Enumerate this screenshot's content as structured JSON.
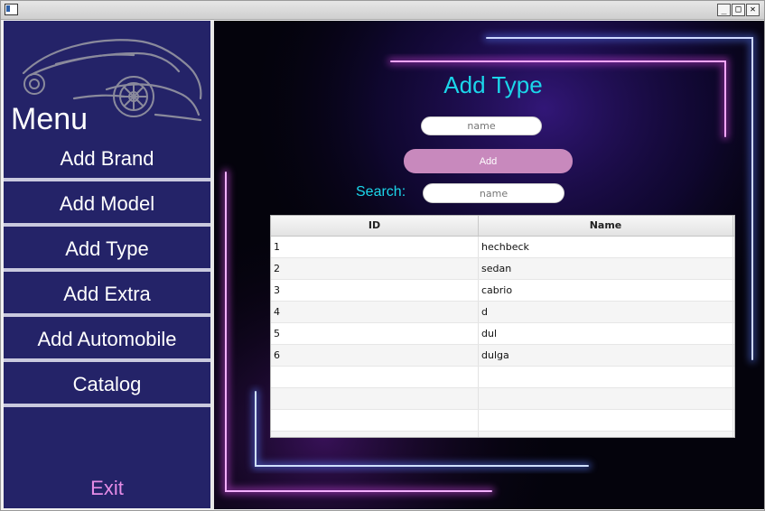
{
  "titlebar": {
    "buttons": [
      "_",
      "□",
      "✕"
    ]
  },
  "sidebar": {
    "logo_icon": "car-silhouette-icon",
    "menu_title": "Menu",
    "items": [
      {
        "label": "Add Brand"
      },
      {
        "label": "Add Model"
      },
      {
        "label": "Add Type"
      },
      {
        "label": "Add Extra"
      },
      {
        "label": "Add Automobile"
      },
      {
        "label": "Catalog"
      }
    ],
    "exit_label": "Exit"
  },
  "main": {
    "title": "Add Type",
    "name_placeholder": "name",
    "add_label": "Add",
    "search_label": "Search:",
    "search_placeholder": "name",
    "table": {
      "columns": [
        "ID",
        "Name"
      ],
      "rows": [
        [
          "1",
          "hechbeck"
        ],
        [
          "2",
          "sedan"
        ],
        [
          "3",
          "cabrio"
        ],
        [
          "4",
          "d"
        ],
        [
          "5",
          "dul"
        ],
        [
          "6",
          "dulga"
        ],
        [
          "",
          ""
        ],
        [
          "",
          ""
        ],
        [
          "",
          ""
        ],
        [
          "",
          ""
        ]
      ]
    }
  },
  "colors": {
    "sidebar_bg": "#242368",
    "accent_cyan": "#1bd6ea",
    "button_pink": "#c889bd",
    "exit_pink": "#e58ce6"
  }
}
